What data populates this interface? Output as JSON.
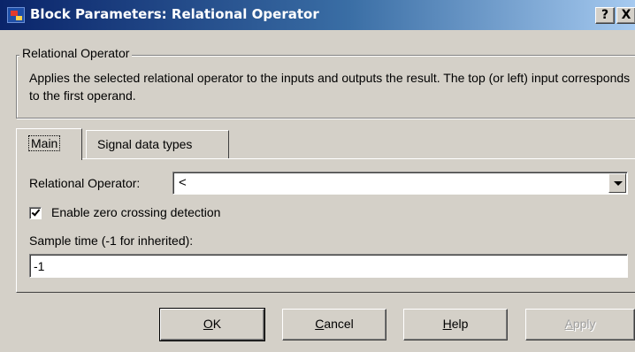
{
  "window": {
    "title": "Block Parameters: Relational Operator",
    "help_button": "?",
    "close_button": "X"
  },
  "group": {
    "legend": "Relational Operator",
    "description": "Applies the selected relational operator to the inputs and outputs the result. The top (or left) input corresponds to the first operand."
  },
  "tabs": [
    {
      "label": "Main",
      "selected": true
    },
    {
      "label": "Signal data types",
      "selected": false
    }
  ],
  "main": {
    "operator_label": "Relational Operator:",
    "operator_value": "<",
    "zero_crossing_label": "Enable zero crossing detection",
    "zero_crossing_checked": true,
    "sample_time_label": "Sample time (-1 for inherited):",
    "sample_time_value": "-1"
  },
  "buttons": {
    "ok_accel": "O",
    "ok_rest": "K",
    "cancel_accel": "C",
    "cancel_rest": "ancel",
    "help_accel": "H",
    "help_rest": "elp",
    "apply_accel": "A",
    "apply_rest": "pply",
    "apply_enabled": false
  },
  "colors": {
    "titlebar_start": "#0a246a",
    "titlebar_end": "#a6caf0",
    "face": "#d4d0c8"
  }
}
